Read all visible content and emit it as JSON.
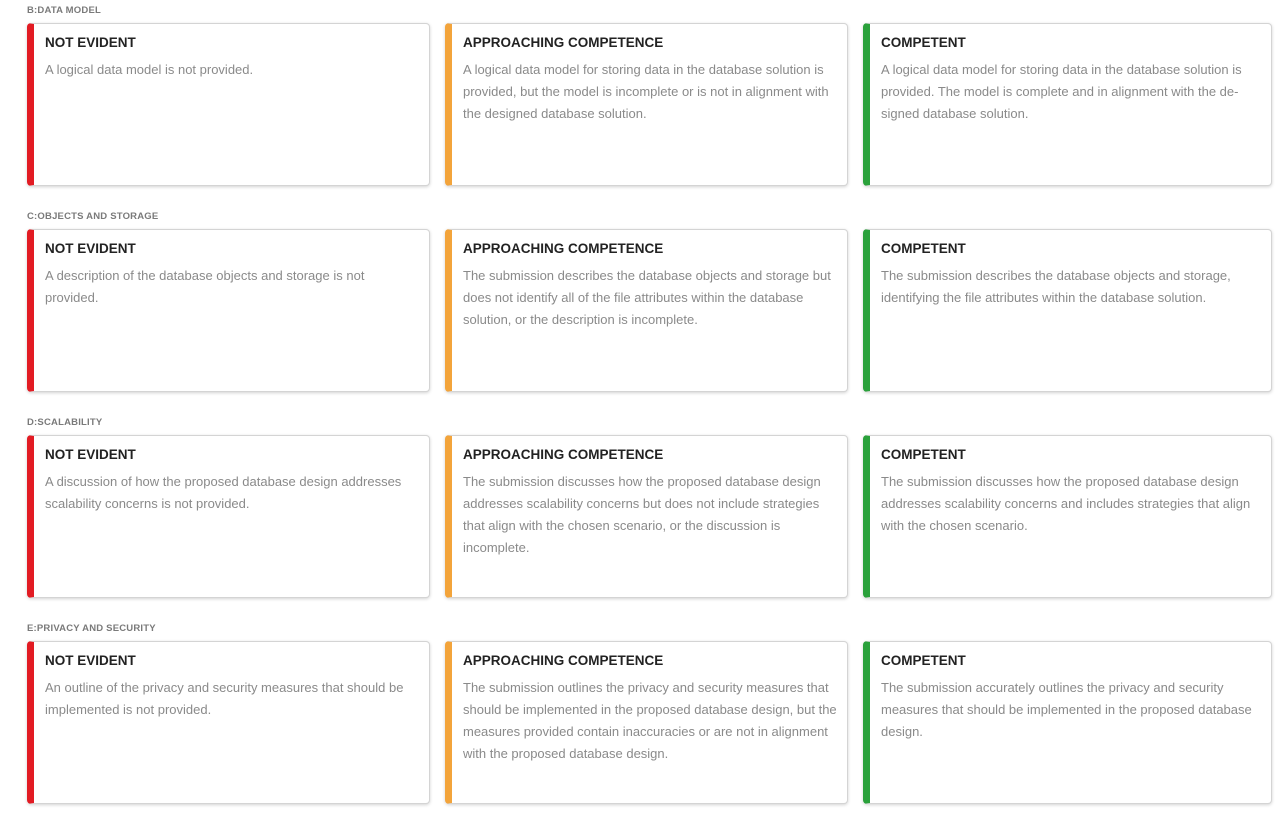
{
  "colors": {
    "not_evident": "#e21b23",
    "approaching": "#f3a43b",
    "competent": "#2aa13b"
  },
  "sections": [
    {
      "label": "B:DATA MODEL",
      "cards": [
        {
          "title": "NOT EVIDENT",
          "description": "A logical data model is not provided."
        },
        {
          "title": "APPROACHING COMPETENCE",
          "description": "A logical data model for storing data in the database solution is provided, but the model is incomplete or is not in alignment with the designed database solution."
        },
        {
          "title": "COMPETENT",
          "description": "A logical data model for storing data in the database solution is provided. The model is complete and in alignment with the de­signed database solution."
        }
      ]
    },
    {
      "label": "C:OBJECTS AND STORAGE",
      "cards": [
        {
          "title": "NOT EVIDENT",
          "description": "A description of the database objects and storage is not provided."
        },
        {
          "title": "APPROACHING COMPETENCE",
          "description": "The submission describes the database objects and storage but does not identify all of the file attributes within the data­base solution, or the description is incomplete."
        },
        {
          "title": "COMPETENT",
          "description": "The submission describes the database objects and storage, identifying the file attributes within the database solution."
        }
      ]
    },
    {
      "label": "D:SCALABILITY",
      "cards": [
        {
          "title": "NOT EVIDENT",
          "description": "A discussion of how the proposed database design addresses scalability concerns is not provided."
        },
        {
          "title": "APPROACHING COMPETENCE",
          "description": "The submission discusses how the proposed database design addresses scalability concerns but does not include strategies that align with the chosen scenario, or the discussion is incomplete."
        },
        {
          "title": "COMPETENT",
          "description": "The submission discusses how the proposed database design addresses scalability concerns and includes strategies that align with the chosen scenario."
        }
      ]
    },
    {
      "label": "E:PRIVACY AND SECURITY",
      "cards": [
        {
          "title": "NOT EVIDENT",
          "description": "An outline of the privacy and security measures that should be implemented is not provided."
        },
        {
          "title": "APPROACHING COMPETENCE",
          "description": "The submission outlines the privacy and security measures that should be implemented in the proposed database design, but the measures provided contain inaccuracies or are not in alignment with the proposed database design."
        },
        {
          "title": "COMPETENT",
          "description": "The submission accurately outlines the privacy and security measures that should be implemented in the proposed data­base design."
        }
      ]
    }
  ]
}
